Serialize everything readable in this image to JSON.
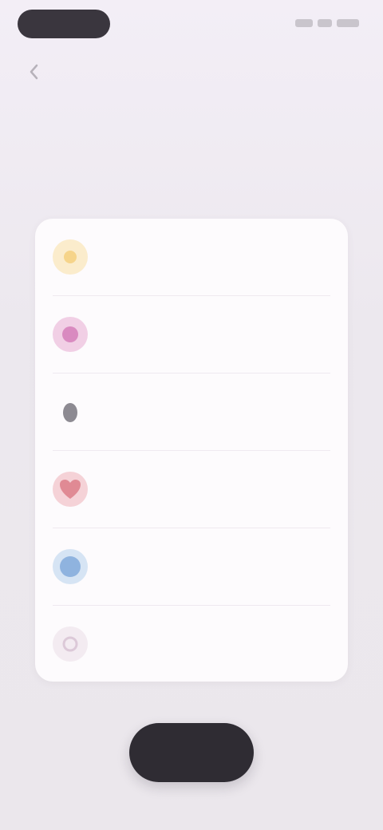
{
  "header": {
    "back_icon": "chevron-left-icon"
  },
  "question": {
    "title": ""
  },
  "options": [
    {
      "label": "",
      "icon": "sun-icon",
      "color": "#f6d48a"
    },
    {
      "label": "",
      "icon": "flower-icon",
      "color": "#d98ac0"
    },
    {
      "label": "",
      "icon": "leaf-icon",
      "color": "#8d8a92"
    },
    {
      "label": "",
      "icon": "heart-icon",
      "color": "#e08a94"
    },
    {
      "label": "",
      "icon": "globe-icon",
      "color": "#8fb3df"
    },
    {
      "label": "",
      "icon": "sparkle-icon",
      "color": "#dcc9d8"
    }
  ],
  "footer": {
    "continue_label": ""
  },
  "colors": {
    "button": "#2f2c33",
    "card": "#fdfbfd",
    "background": "#ece8ee"
  }
}
